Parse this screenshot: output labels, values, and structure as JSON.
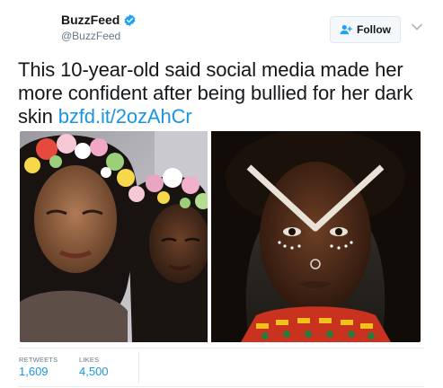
{
  "author": {
    "name": "BuzzFeed",
    "handle": "@BuzzFeed",
    "verified": true
  },
  "follow_button": {
    "label": "Follow",
    "icon": "add-user-icon"
  },
  "menu": {
    "icon": "chevron-down-icon"
  },
  "tweet": {
    "text": "This 10-year-old said social media made her more confident after being bullied for her dark skin",
    "link": "bzfd.it/2ozAhCr"
  },
  "media": {
    "photos": [
      {
        "description_icon": "photo-selfie-flower-crown"
      },
      {
        "description_icon": "photo-portrait-gold-headpiece"
      }
    ]
  },
  "stats": {
    "retweets_label": "RETWEETS",
    "retweets_value": "1,609",
    "likes_label": "LIKES",
    "likes_value": "4,500"
  },
  "colors": {
    "link": "#1b95e0",
    "verified": "#1da1f2",
    "text": "#14171a",
    "muted": "#657786"
  }
}
